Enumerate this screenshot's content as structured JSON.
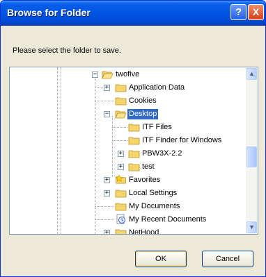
{
  "window": {
    "title": "Browse for Folder",
    "help_label": "?",
    "close_label": "X"
  },
  "prompt": "Please select the folder to save.",
  "tree": {
    "items": [
      {
        "label": "twofive",
        "expander": "−",
        "icon": "folder-open-icon"
      },
      {
        "label": "Application Data",
        "expander": "+",
        "icon": "folder-icon"
      },
      {
        "label": "Cookies",
        "expander": "",
        "icon": "folder-icon"
      },
      {
        "label": "Desktop",
        "expander": "−",
        "icon": "folder-open-icon",
        "selected": true
      },
      {
        "label": "ITF Files",
        "expander": "",
        "icon": "folder-icon"
      },
      {
        "label": "ITF Finder for Windows",
        "expander": "",
        "icon": "folder-icon"
      },
      {
        "label": "PBW3X-2.2",
        "expander": "+",
        "icon": "folder-icon"
      },
      {
        "label": "test",
        "expander": "+",
        "icon": "folder-icon"
      },
      {
        "label": "Favorites",
        "expander": "+",
        "icon": "star-folder-icon"
      },
      {
        "label": "Local Settings",
        "expander": "+",
        "icon": "folder-icon"
      },
      {
        "label": "My Documents",
        "expander": "",
        "icon": "folder-icon"
      },
      {
        "label": "My Recent Documents",
        "expander": "",
        "icon": "recent-documents-icon"
      },
      {
        "label": "NetHood",
        "expander": "+",
        "icon": "folder-icon"
      }
    ]
  },
  "scrollbar": {
    "up_glyph": "▲",
    "down_glyph": "▼"
  },
  "buttons": {
    "ok": "OK",
    "cancel": "Cancel"
  },
  "colors": {
    "titlebar": "#0055e5",
    "selection": "#316ac5",
    "dialog_bg": "#ece9d8",
    "folder": "#f5d46b"
  }
}
